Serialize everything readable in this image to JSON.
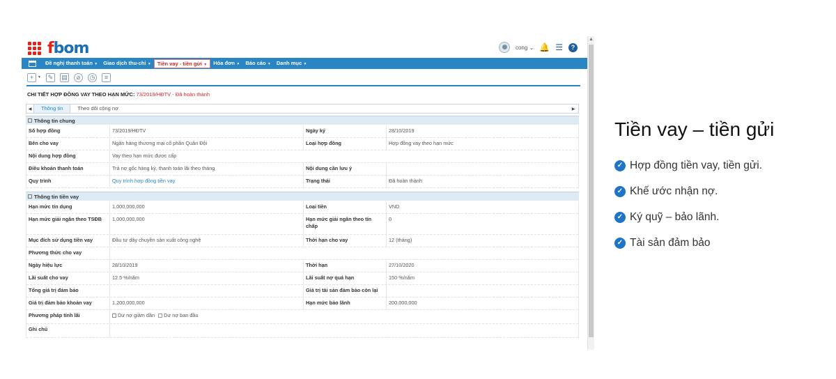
{
  "app": {
    "logo_text_f": "f",
    "logo_text_rest": "bom",
    "username": "cong"
  },
  "menu": {
    "items": [
      {
        "label": "Đề nghị thanh toán",
        "active": false
      },
      {
        "label": "Giao dịch thu-chi",
        "active": false
      },
      {
        "label": "Tiền vay - tiền gửi",
        "active": true
      },
      {
        "label": "Hóa đơn",
        "active": false
      },
      {
        "label": "Báo cáo",
        "active": false
      },
      {
        "label": "Danh mục",
        "active": false
      }
    ]
  },
  "detail": {
    "title": "CHI TIẾT HỢP ĐỒNG VAY THEO HẠN MỨC:",
    "code": "73/2019/HĐTV",
    "status": "- Đã hoàn thành"
  },
  "tabs": [
    {
      "label": "Thông tin",
      "active": true
    },
    {
      "label": "Theo dõi công nợ",
      "active": false
    }
  ],
  "section_general": {
    "title": "Thông tin chung",
    "rows": [
      {
        "l1": "Số hợp đồng",
        "v1": "73/2019/HĐTV",
        "l2": "Ngày ký",
        "v2": "28/10/2019"
      },
      {
        "l1": "Bên cho vay",
        "v1": "Ngân hàng thương mại cổ phần Quân Đội",
        "l2": "Loại hợp đồng",
        "v2": "Hợp đồng vay theo hạn mức"
      },
      {
        "l1": "Nội dung hợp đồng",
        "v1": "Vay theo hạn mức được cấp",
        "l2": "",
        "v2": ""
      },
      {
        "l1": "Điều khoản thanh toán",
        "v1": "Trả nợ gốc hàng kỳ, thanh toán lãi theo tháng",
        "l2": "Nội dung cần lưu ý",
        "v2": ""
      },
      {
        "l1": "Quy trình",
        "v1": "Quy trình hợp đồng tiền vay",
        "l2": "Trạng thái",
        "v2": "Đã hoàn thành"
      }
    ]
  },
  "section_loan": {
    "title": "Thông tin tiền vay",
    "rows": [
      {
        "l1": "Hạn mức tín dụng",
        "v1": "1,000,000,000",
        "l2": "Loại tiền",
        "v2": "VND"
      },
      {
        "l1": "Hạn mức giải ngân theo TSĐB",
        "v1": "1,000,000,000",
        "l2": "Hạn mức giải ngân theo tín chấp",
        "v2": "0"
      },
      {
        "l1": "Mục đích sử dụng tiền vay",
        "v1": "Đầu tư dây chuyền sản xuất công nghệ",
        "l2": "Thời hạn cho vay",
        "v2": "12 (tháng)"
      },
      {
        "l1": "Phương thức cho vay",
        "v1": "",
        "l2": "",
        "v2": ""
      },
      {
        "l1": "Ngày hiệu lực",
        "v1": "28/10/2019",
        "l2": "Thời hạn",
        "v2": "27/10/2020"
      },
      {
        "l1": "Lãi suất cho vay",
        "v1": "12.5 %/năm",
        "l2": "Lãi suất nợ quá hạn",
        "v2": "150 %/năm"
      },
      {
        "l1": "Tổng giá trị đảm bảo",
        "v1": "",
        "l2": "Giá trị tài sản đảm bảo còn lại",
        "v2": ""
      },
      {
        "l1": "Giá trị đảm bảo khoản vay",
        "v1": "1,200,000,000",
        "l2": "Hạn mức bảo lãnh",
        "v2": "200,000,000"
      }
    ],
    "interest_method_label": "Phương pháp tính lãi",
    "interest_opt1": "Dư nợ giảm dần",
    "interest_opt2": "Dư nợ ban đầu",
    "notes_label": "Ghi chú"
  },
  "right_panel": {
    "title": "Tiền vay – tiền gửi",
    "items": [
      "Hợp đồng tiền vay, tiền gửi.",
      "Khế ước nhận nợ.",
      "Ký quỹ – bảo lãnh.",
      "Tài sản đảm bảo"
    ]
  }
}
